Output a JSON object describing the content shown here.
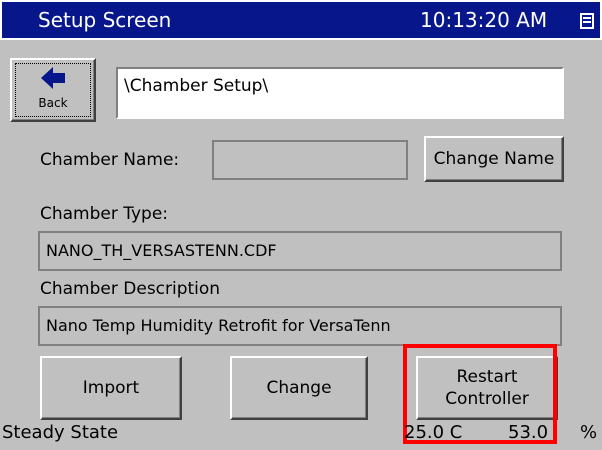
{
  "titlebar": {
    "title": "Setup Screen",
    "time": "10:13:20 AM",
    "tray_icon": "window-tray-icon"
  },
  "back_button": {
    "label": "Back",
    "icon": "arrow-left-icon"
  },
  "path": {
    "value": "\\Chamber Setup\\"
  },
  "chamber_name": {
    "label": "Chamber Name:",
    "value": "",
    "change_button": "Change Name"
  },
  "chamber_type": {
    "label": "Chamber Type:",
    "value": "NANO_TH_VERSASTENN.CDF"
  },
  "chamber_description": {
    "label": "Chamber Description",
    "value": "Nano Temp Humidity Retrofit for VersaTenn"
  },
  "actions": {
    "import": "Import",
    "change": "Change",
    "restart_line1": "Restart",
    "restart_line2": "Controller"
  },
  "status_bar": {
    "state": "Steady State",
    "temperature": "25.0 C",
    "humidity": "53.0",
    "humidity_unit": "%"
  },
  "colors": {
    "titlebar_bg": "#07168a",
    "panel_bg": "#c0c0c0",
    "highlight": "#ff0000"
  }
}
